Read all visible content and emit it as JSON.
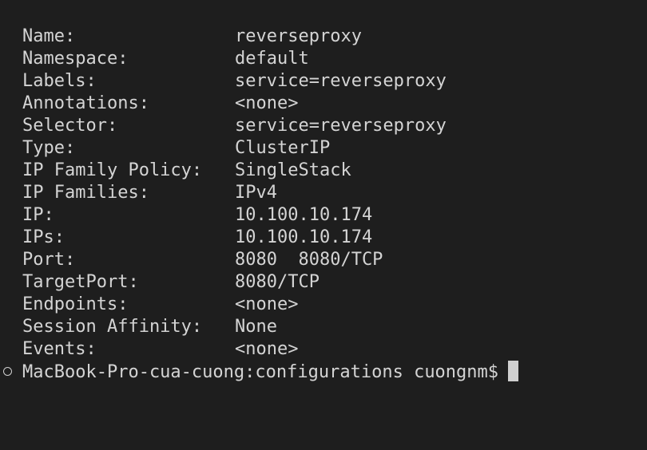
{
  "terminal": {
    "rows": [
      {
        "key": "Name:",
        "value": "reverseproxy"
      },
      {
        "key": "Namespace:",
        "value": "default"
      },
      {
        "key": "Labels:",
        "value": "service=reverseproxy"
      },
      {
        "key": "Annotations:",
        "value": "<none>"
      },
      {
        "key": "Selector:",
        "value": "service=reverseproxy"
      },
      {
        "key": "Type:",
        "value": "ClusterIP"
      },
      {
        "key": "IP Family Policy:",
        "value": "SingleStack"
      },
      {
        "key": "IP Families:",
        "value": "IPv4"
      },
      {
        "key": "IP:",
        "value": "10.100.10.174"
      },
      {
        "key": "IPs:",
        "value": "10.100.10.174"
      },
      {
        "key": "Port:",
        "value": "8080  8080/TCP"
      },
      {
        "key": "TargetPort:",
        "value": "8080/TCP"
      },
      {
        "key": "Endpoints:",
        "value": "<none>"
      },
      {
        "key": "Session Affinity:",
        "value": "None"
      },
      {
        "key": "Events:",
        "value": "<none>"
      }
    ],
    "prompt": "MacBook-Pro-cua-cuong:configurations cuongnm$"
  },
  "colors": {
    "background": "#1e1e1e",
    "text": "#d4d4d4",
    "cursor": "#cfcfcf"
  }
}
